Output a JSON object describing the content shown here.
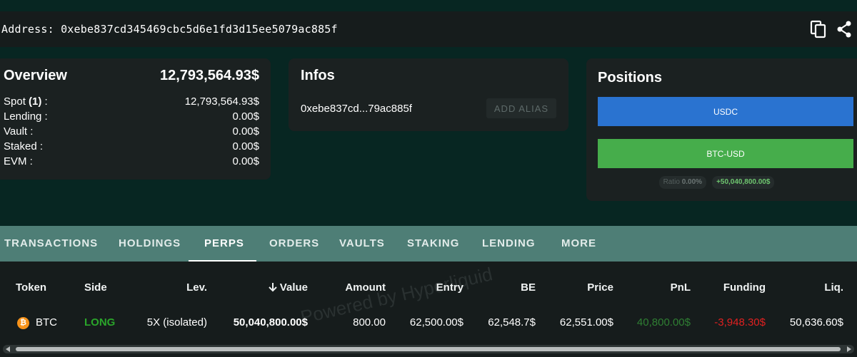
{
  "header": {
    "address": "Address: 0xebe837cd345469cbc5d6e1fd3d15ee5079ac885f",
    "copy_icon": "copy-icon",
    "share_icon": "share-icon"
  },
  "overview": {
    "title": "Overview",
    "total": "12,793,564.93$",
    "rows": [
      {
        "label": "Spot ",
        "count": "(1)",
        "suffix": " :",
        "value": "12,793,564.93$"
      },
      {
        "label": "Lending :",
        "value": "0.00$"
      },
      {
        "label": "Vault :",
        "value": "0.00$"
      },
      {
        "label": "Staked :",
        "value": "0.00$"
      },
      {
        "label": "EVM :",
        "value": "0.00$"
      }
    ]
  },
  "infos": {
    "title": "Infos",
    "short_address": "0xebe837cd...79ac885f",
    "alias_button": "ADD ALIAS"
  },
  "positions": {
    "title": "Positions",
    "buttons": [
      "USDC",
      "BTC-USD"
    ],
    "ratio_label": "Ratio",
    "ratio_value": "0.00%",
    "pnl_badge": "+50,040,800.00$"
  },
  "tabs": [
    "TRANSACTIONS",
    "HOLDINGS",
    "PERPS",
    "ORDERS",
    "VAULTS",
    "STAKING",
    "LENDING",
    "MORE"
  ],
  "active_tab": "PERPS",
  "table": {
    "headers": [
      "Token",
      "Side",
      "Lev.",
      "Value",
      "Amount",
      "Entry",
      "BE",
      "Price",
      "PnL",
      "Funding",
      "Liq."
    ],
    "sort_icon": "arrow-down-icon",
    "rows": [
      {
        "token": "BTC",
        "token_icon": "bitcoin-icon",
        "side": "LONG",
        "lev": "5X (isolated)",
        "value": "50,040,800.00$",
        "amount": "800.00",
        "entry": "62,500.00$",
        "be": "62,548.7$",
        "price": "62,551.00$",
        "pnl": "40,800.00$",
        "funding": "-3,948.30$",
        "liq": "50,636.60$"
      }
    ],
    "watermark": "Powered by Hyperliquid"
  },
  "colors": {
    "background": "#072622",
    "card": "#1b2121",
    "tabbar": "#4e7e76",
    "usdc": "#2a73d0",
    "btc_usd": "#46ad4b",
    "long": "#2aa52a",
    "pnl": "#2f7f33",
    "funding": "#e02020"
  }
}
